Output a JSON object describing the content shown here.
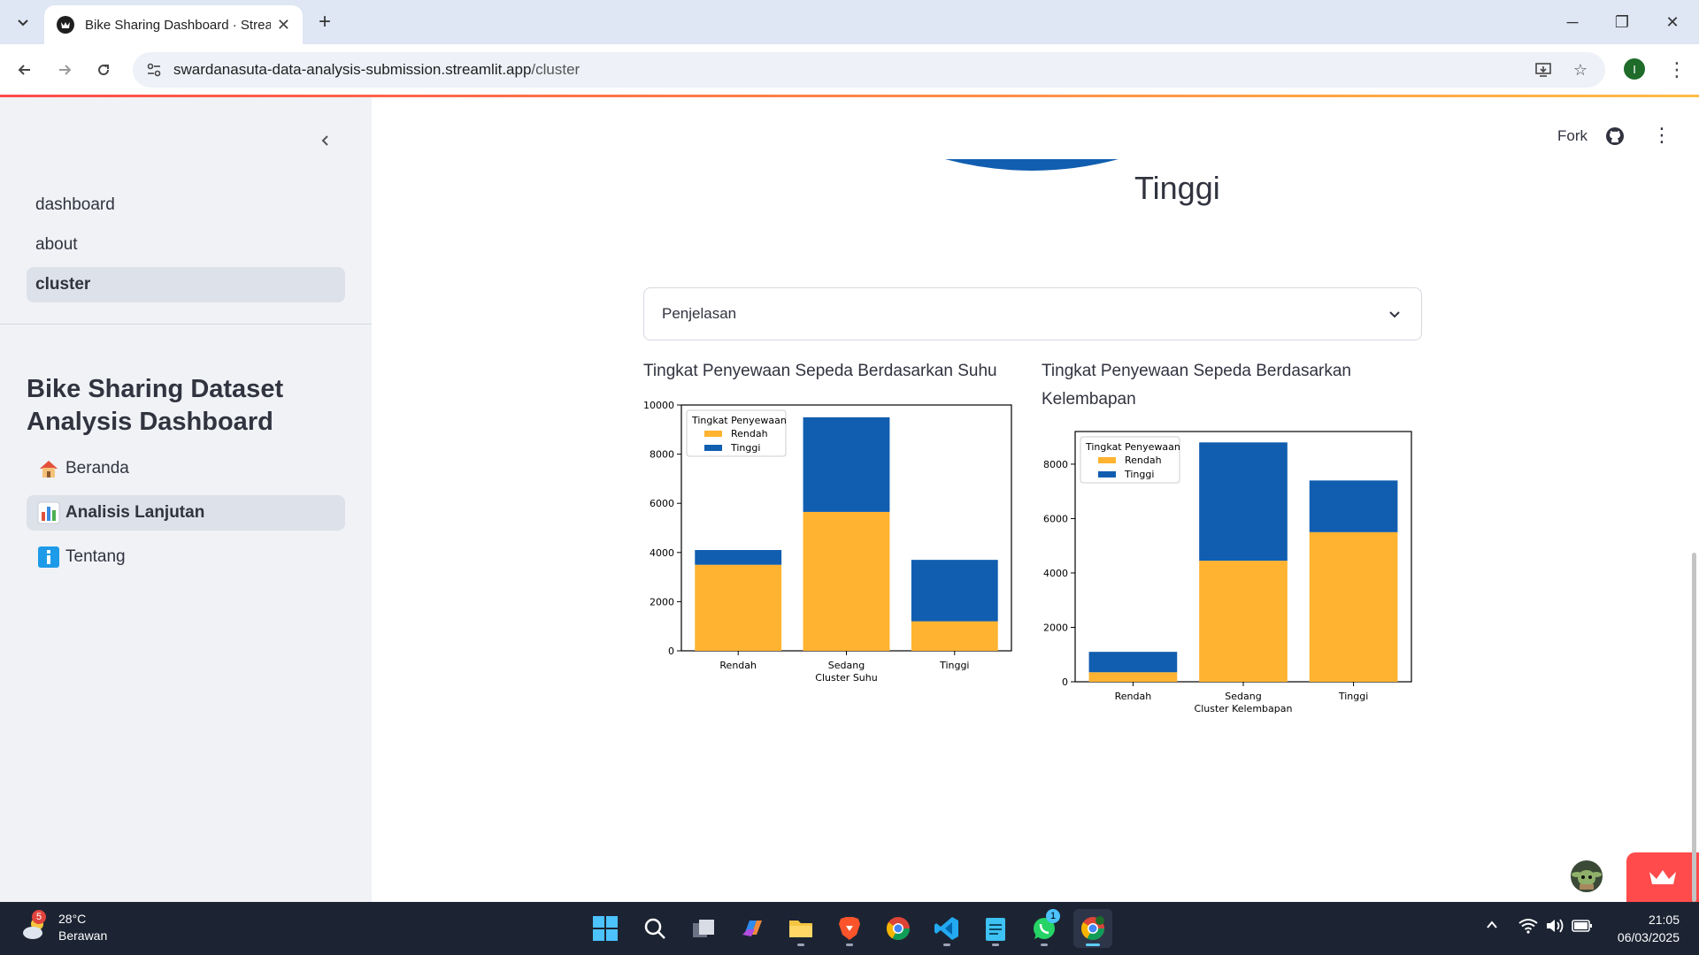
{
  "browser": {
    "tab_title": "Bike Sharing Dashboard · Streamlit",
    "url_domain": "swardanasuta-data-analysis-submission.streamlit.app",
    "url_path": "/cluster",
    "profile_initial": "I"
  },
  "sidebar": {
    "nav_links": [
      {
        "label": "dashboard"
      },
      {
        "label": "about"
      },
      {
        "label": "cluster",
        "active": true
      }
    ],
    "title": "Bike Sharing Dataset Analysis Dashboard",
    "menu": [
      {
        "label": "Beranda",
        "icon": "house-icon"
      },
      {
        "label": "Analisis Lanjutan",
        "icon": "bar-chart-icon",
        "active": true
      },
      {
        "label": "Tentang",
        "icon": "info-icon"
      }
    ]
  },
  "header": {
    "fork_label": "Fork"
  },
  "main": {
    "top_label": "Tinggi",
    "expander_label": "Penjelasan"
  },
  "chart_data": [
    {
      "type": "bar",
      "stacked": true,
      "title": "Tingkat Penyewaan Sepeda Berdasarkan Suhu",
      "xlabel": "Cluster Suhu",
      "ylabel": "",
      "categories": [
        "Rendah",
        "Sedang",
        "Tinggi"
      ],
      "series": [
        {
          "name": "Rendah",
          "values": [
            3500,
            5650,
            1200
          ],
          "color": "#ffb330"
        },
        {
          "name": "Tinggi",
          "values": [
            600,
            3850,
            2500
          ],
          "color": "#115eb0"
        }
      ],
      "ylim": [
        0,
        10000
      ],
      "yticks": [
        0,
        2000,
        4000,
        6000,
        8000,
        10000
      ],
      "legend_title": "Tingkat Penyewaan",
      "legend_position": "top-left"
    },
    {
      "type": "bar",
      "stacked": true,
      "title": "Tingkat Penyewaan Sepeda Berdasarkan Kelembapan",
      "xlabel": "Cluster Kelembapan",
      "ylabel": "",
      "categories": [
        "Rendah",
        "Sedang",
        "Tinggi"
      ],
      "series": [
        {
          "name": "Rendah",
          "values": [
            350,
            4450,
            5500
          ],
          "color": "#ffb330"
        },
        {
          "name": "Tinggi",
          "values": [
            750,
            4350,
            1900
          ],
          "color": "#115eb0"
        }
      ],
      "ylim": [
        0,
        9200
      ],
      "yticks": [
        0,
        2000,
        4000,
        6000,
        8000
      ],
      "legend_title": "Tingkat Penyewaan",
      "legend_position": "top-left"
    }
  ],
  "taskbar": {
    "weather_temp": "28°C",
    "weather_desc": "Berawan",
    "weather_badge": "5",
    "whatsapp_badge": "1",
    "time": "21:05",
    "date": "06/03/2025"
  }
}
